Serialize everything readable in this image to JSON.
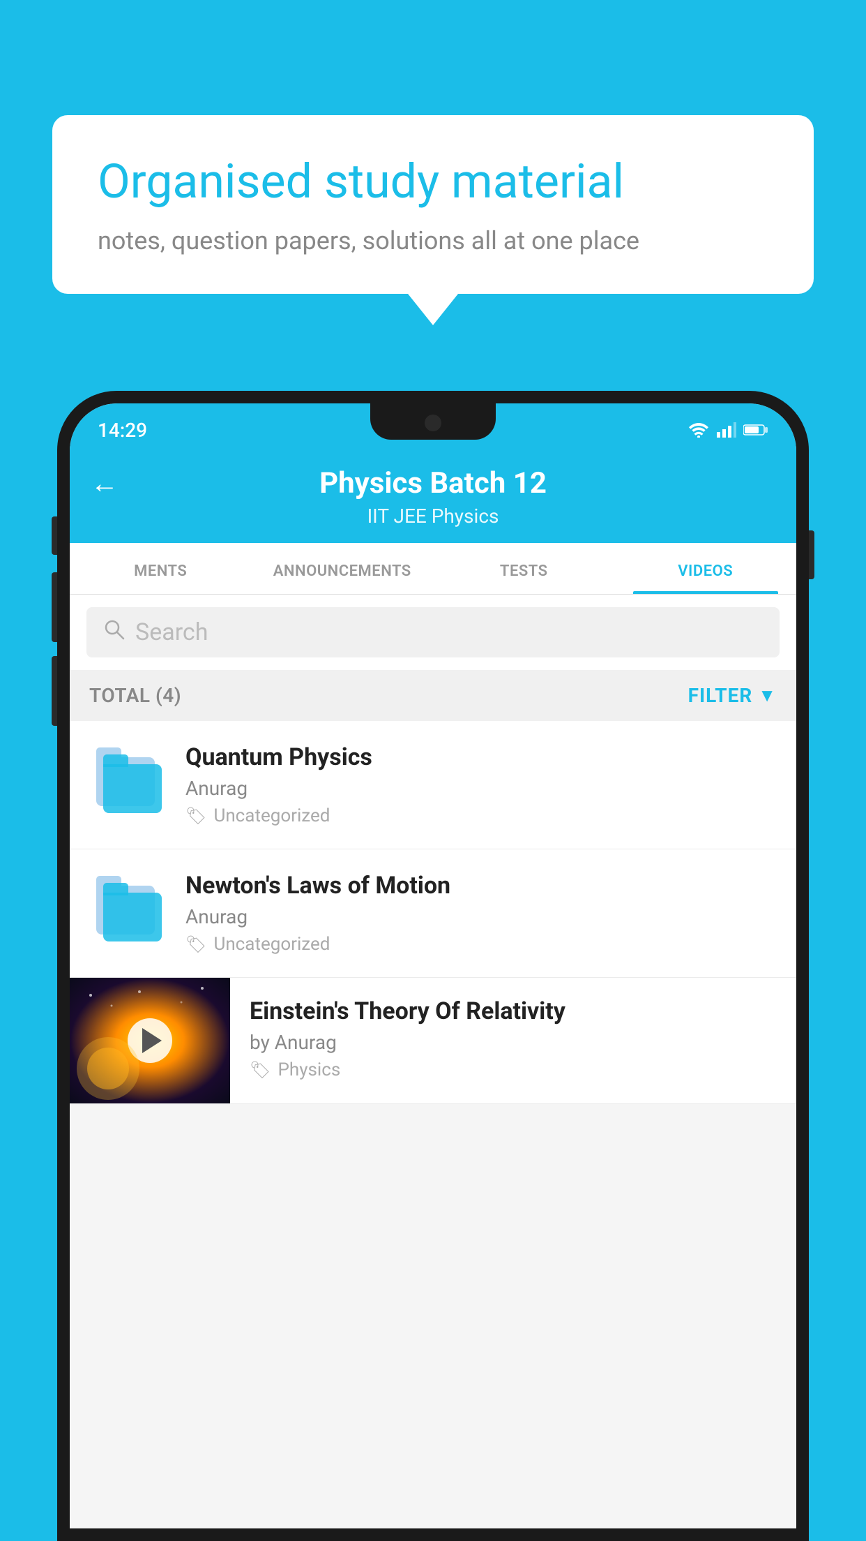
{
  "background_color": "#1bbde8",
  "bubble": {
    "title": "Organised study material",
    "subtitle": "notes, question papers, solutions all at one place"
  },
  "status_bar": {
    "time": "14:29",
    "icons": [
      "wifi",
      "signal",
      "battery"
    ]
  },
  "header": {
    "title": "Physics Batch 12",
    "subtitle": "IIT JEE   Physics",
    "back_label": "←"
  },
  "tabs": [
    {
      "label": "MENTS",
      "active": false
    },
    {
      "label": "ANNOUNCEMENTS",
      "active": false
    },
    {
      "label": "TESTS",
      "active": false
    },
    {
      "label": "VIDEOS",
      "active": true
    }
  ],
  "search": {
    "placeholder": "Search"
  },
  "list_meta": {
    "total_label": "TOTAL (4)",
    "filter_label": "FILTER"
  },
  "videos": [
    {
      "title": "Quantum Physics",
      "author": "Anurag",
      "tag": "Uncategorized",
      "type": "folder"
    },
    {
      "title": "Newton's Laws of Motion",
      "author": "Anurag",
      "tag": "Uncategorized",
      "type": "folder"
    },
    {
      "title": "Einstein's Theory Of Relativity",
      "author": "by Anurag",
      "tag": "Physics",
      "type": "video"
    }
  ]
}
